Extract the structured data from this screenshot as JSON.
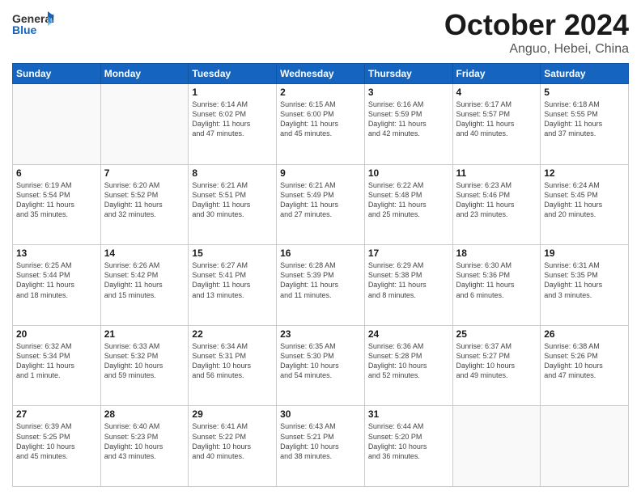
{
  "header": {
    "logo_general": "General",
    "logo_blue": "Blue",
    "month": "October 2024",
    "location": "Anguo, Hebei, China"
  },
  "days_of_week": [
    "Sunday",
    "Monday",
    "Tuesday",
    "Wednesday",
    "Thursday",
    "Friday",
    "Saturday"
  ],
  "weeks": [
    [
      {
        "day": "",
        "info": ""
      },
      {
        "day": "",
        "info": ""
      },
      {
        "day": "1",
        "info": "Sunrise: 6:14 AM\nSunset: 6:02 PM\nDaylight: 11 hours\nand 47 minutes."
      },
      {
        "day": "2",
        "info": "Sunrise: 6:15 AM\nSunset: 6:00 PM\nDaylight: 11 hours\nand 45 minutes."
      },
      {
        "day": "3",
        "info": "Sunrise: 6:16 AM\nSunset: 5:59 PM\nDaylight: 11 hours\nand 42 minutes."
      },
      {
        "day": "4",
        "info": "Sunrise: 6:17 AM\nSunset: 5:57 PM\nDaylight: 11 hours\nand 40 minutes."
      },
      {
        "day": "5",
        "info": "Sunrise: 6:18 AM\nSunset: 5:55 PM\nDaylight: 11 hours\nand 37 minutes."
      }
    ],
    [
      {
        "day": "6",
        "info": "Sunrise: 6:19 AM\nSunset: 5:54 PM\nDaylight: 11 hours\nand 35 minutes."
      },
      {
        "day": "7",
        "info": "Sunrise: 6:20 AM\nSunset: 5:52 PM\nDaylight: 11 hours\nand 32 minutes."
      },
      {
        "day": "8",
        "info": "Sunrise: 6:21 AM\nSunset: 5:51 PM\nDaylight: 11 hours\nand 30 minutes."
      },
      {
        "day": "9",
        "info": "Sunrise: 6:21 AM\nSunset: 5:49 PM\nDaylight: 11 hours\nand 27 minutes."
      },
      {
        "day": "10",
        "info": "Sunrise: 6:22 AM\nSunset: 5:48 PM\nDaylight: 11 hours\nand 25 minutes."
      },
      {
        "day": "11",
        "info": "Sunrise: 6:23 AM\nSunset: 5:46 PM\nDaylight: 11 hours\nand 23 minutes."
      },
      {
        "day": "12",
        "info": "Sunrise: 6:24 AM\nSunset: 5:45 PM\nDaylight: 11 hours\nand 20 minutes."
      }
    ],
    [
      {
        "day": "13",
        "info": "Sunrise: 6:25 AM\nSunset: 5:44 PM\nDaylight: 11 hours\nand 18 minutes."
      },
      {
        "day": "14",
        "info": "Sunrise: 6:26 AM\nSunset: 5:42 PM\nDaylight: 11 hours\nand 15 minutes."
      },
      {
        "day": "15",
        "info": "Sunrise: 6:27 AM\nSunset: 5:41 PM\nDaylight: 11 hours\nand 13 minutes."
      },
      {
        "day": "16",
        "info": "Sunrise: 6:28 AM\nSunset: 5:39 PM\nDaylight: 11 hours\nand 11 minutes."
      },
      {
        "day": "17",
        "info": "Sunrise: 6:29 AM\nSunset: 5:38 PM\nDaylight: 11 hours\nand 8 minutes."
      },
      {
        "day": "18",
        "info": "Sunrise: 6:30 AM\nSunset: 5:36 PM\nDaylight: 11 hours\nand 6 minutes."
      },
      {
        "day": "19",
        "info": "Sunrise: 6:31 AM\nSunset: 5:35 PM\nDaylight: 11 hours\nand 3 minutes."
      }
    ],
    [
      {
        "day": "20",
        "info": "Sunrise: 6:32 AM\nSunset: 5:34 PM\nDaylight: 11 hours\nand 1 minute."
      },
      {
        "day": "21",
        "info": "Sunrise: 6:33 AM\nSunset: 5:32 PM\nDaylight: 10 hours\nand 59 minutes."
      },
      {
        "day": "22",
        "info": "Sunrise: 6:34 AM\nSunset: 5:31 PM\nDaylight: 10 hours\nand 56 minutes."
      },
      {
        "day": "23",
        "info": "Sunrise: 6:35 AM\nSunset: 5:30 PM\nDaylight: 10 hours\nand 54 minutes."
      },
      {
        "day": "24",
        "info": "Sunrise: 6:36 AM\nSunset: 5:28 PM\nDaylight: 10 hours\nand 52 minutes."
      },
      {
        "day": "25",
        "info": "Sunrise: 6:37 AM\nSunset: 5:27 PM\nDaylight: 10 hours\nand 49 minutes."
      },
      {
        "day": "26",
        "info": "Sunrise: 6:38 AM\nSunset: 5:26 PM\nDaylight: 10 hours\nand 47 minutes."
      }
    ],
    [
      {
        "day": "27",
        "info": "Sunrise: 6:39 AM\nSunset: 5:25 PM\nDaylight: 10 hours\nand 45 minutes."
      },
      {
        "day": "28",
        "info": "Sunrise: 6:40 AM\nSunset: 5:23 PM\nDaylight: 10 hours\nand 43 minutes."
      },
      {
        "day": "29",
        "info": "Sunrise: 6:41 AM\nSunset: 5:22 PM\nDaylight: 10 hours\nand 40 minutes."
      },
      {
        "day": "30",
        "info": "Sunrise: 6:43 AM\nSunset: 5:21 PM\nDaylight: 10 hours\nand 38 minutes."
      },
      {
        "day": "31",
        "info": "Sunrise: 6:44 AM\nSunset: 5:20 PM\nDaylight: 10 hours\nand 36 minutes."
      },
      {
        "day": "",
        "info": ""
      },
      {
        "day": "",
        "info": ""
      }
    ]
  ]
}
